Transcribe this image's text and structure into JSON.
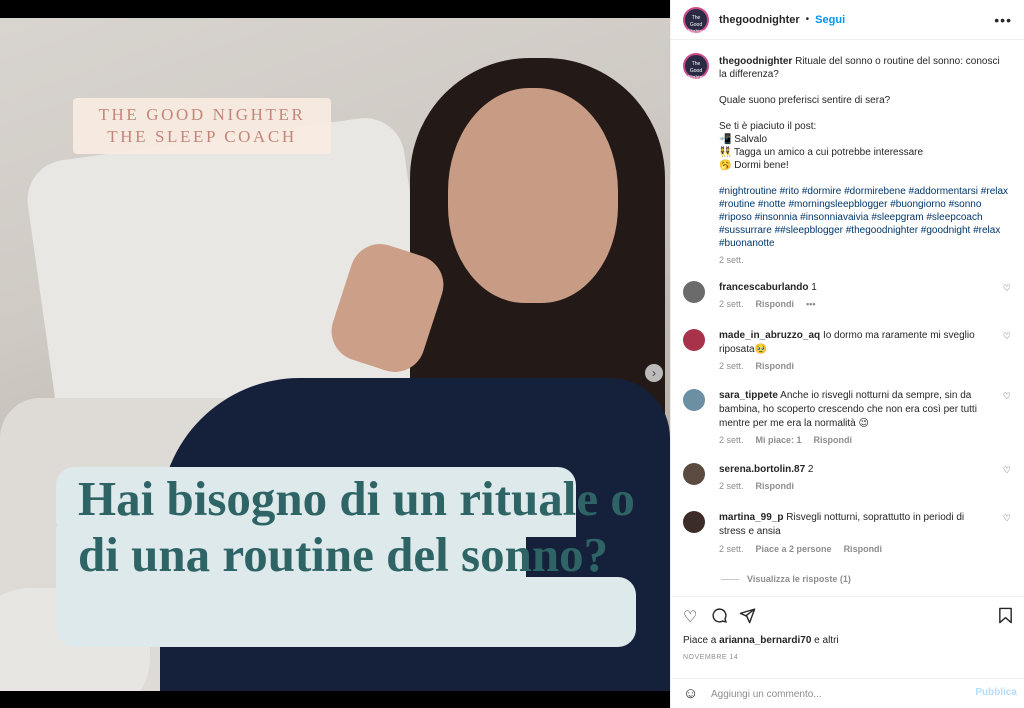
{
  "post": {
    "brand_line1": "THE GOOD NIGHTER",
    "brand_line2": "THE SLEEP COACH",
    "headline": "Hai bisogno di un rituale o di una routine del sonno?",
    "carousel_next": "›"
  },
  "header": {
    "username": "thegoodnighter",
    "separator": "•",
    "follow": "Segui",
    "more": "•••",
    "avatar_text": "The Good Nighter"
  },
  "caption": {
    "username": "thegoodnighter",
    "line1": "Rituale del sonno o routine del sonno: conosci la differenza?",
    "line2": "Quale suono preferisci sentire di sera?",
    "line3": "Se ti è piaciuto il post:",
    "line4": "📲 Salvalo",
    "line5": "👯 Tagga un amico a cui potrebbe interessare",
    "line6": "🥱 Dormi bene!",
    "hashtags": "#nightroutine #rito #dormire #dormirebene #addormentarsi #relax #routine #notte #morningsleepblogger #buongiorno #sonno #riposo #insonnia #insonniavaivia #sleepgram #sleepcoach #sussurrare ##sleepblogger #thegoodnighter #goodnight #relax #buonanotte",
    "time": "2 sett."
  },
  "comments": [
    {
      "user": "francescaburlando",
      "text": "1",
      "time": "2 sett.",
      "likes": "",
      "reply": "Rispondi",
      "more": "•••",
      "avatar_color": "#6b6b6b"
    },
    {
      "user": "made_in_abruzzo_aq",
      "text": "Io dormo ma raramente mi sveglio riposata🥹",
      "time": "2 sett.",
      "likes": "",
      "reply": "Rispondi",
      "avatar_color": "#a8324a"
    },
    {
      "user": "sara_tippete",
      "text": "Anche io risvegli notturni da sempre, sin da bambina, ho scoperto crescendo che non era così per tutti mentre per me era la normalità 😉",
      "time": "2 sett.",
      "likes": "Mi piace: 1",
      "reply": "Rispondi",
      "avatar_color": "#6b8fa3"
    },
    {
      "user": "serena.bortolin.87",
      "text": "2",
      "time": "2 sett.",
      "likes": "",
      "reply": "Rispondi",
      "avatar_color": "#5a4a3f"
    },
    {
      "user": "martina_99_p",
      "text": "Risvegli notturni, soprattutto in periodi di stress e ansia",
      "time": "2 sett.",
      "likes": "Piace a 2 persone",
      "reply": "Rispondi",
      "avatar_color": "#3c2c28"
    }
  ],
  "view_replies": "Visualizza le risposte (1)",
  "actions": {
    "likes_prefix": "Piace a ",
    "likes_user": "arianna_bernardi70",
    "likes_suffix": " e altri",
    "date": "NOVEMBRE 14"
  },
  "add_comment": {
    "placeholder": "Aggiungi un commento...",
    "post": "Pubblica"
  },
  "colors": {
    "accent": "#0095f6",
    "headline": "#2f6467",
    "brand": "#c3867a"
  }
}
